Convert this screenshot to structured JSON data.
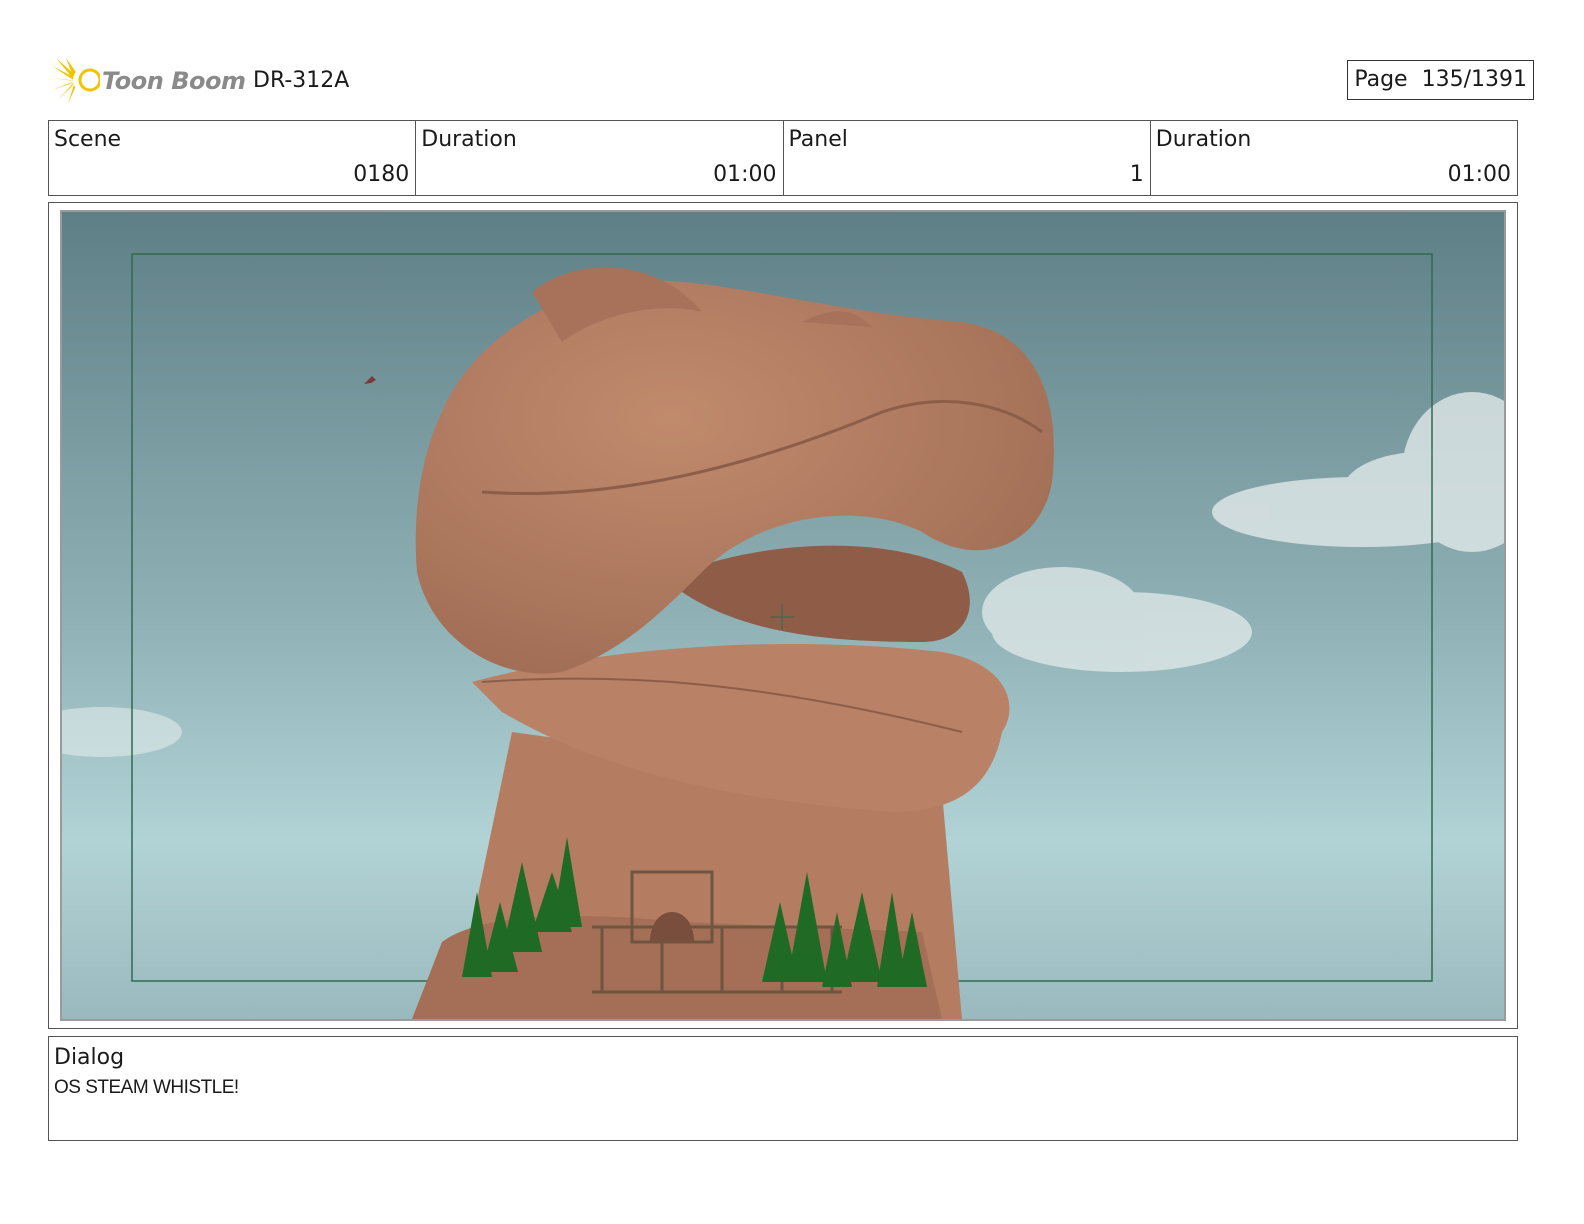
{
  "header": {
    "logo_text": "Toon Boom",
    "production_code": "DR-312A",
    "page_label": "Page",
    "page_number": "135/1391"
  },
  "info": {
    "scene_label": "Scene",
    "scene_value": "0180",
    "scene_duration_label": "Duration",
    "scene_duration_value": "01:00",
    "panel_label": "Panel",
    "panel_value": "1",
    "panel_duration_label": "Duration",
    "panel_duration_value": "01:00"
  },
  "dialog": {
    "label": "Dialog",
    "text": "OS STEAM WHISTLE!"
  },
  "colors": {
    "sky_top": "#5f7f86",
    "sky_bottom": "#a9cdd2",
    "rock": "#b07a60",
    "safe_frame": "#2f6b4e"
  }
}
